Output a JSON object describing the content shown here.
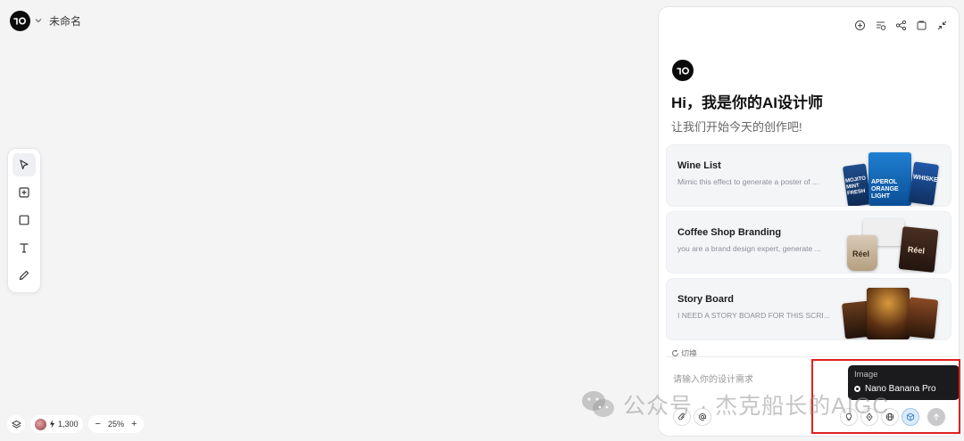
{
  "header": {
    "title": "未命名"
  },
  "toolbar": {
    "tools": [
      {
        "name": "select",
        "icon": "cursor-arrow-icon",
        "active": true
      },
      {
        "name": "add",
        "icon": "plus-square-icon"
      },
      {
        "name": "frame",
        "icon": "square-icon"
      },
      {
        "name": "text",
        "icon": "text-icon"
      },
      {
        "name": "pen",
        "icon": "pen-icon"
      }
    ]
  },
  "bottom": {
    "credits": "1,300",
    "zoom_out": "−",
    "zoom": "25%",
    "zoom_in": "+"
  },
  "panel": {
    "greeting": "Hi，我是你的AI设计师",
    "subgreeting": "让我们开始今天的创作吧!",
    "cards": [
      {
        "title": "Wine List",
        "desc": "Mimic this effect to generate a poster of ..."
      },
      {
        "title": "Coffee Shop Branding",
        "desc": "you are a brand design expert, generate ..."
      },
      {
        "title": "Story Board",
        "desc": "I NEED A STORY BOARD FOR THIS SCRI..."
      }
    ],
    "switch_label": "切换",
    "input_placeholder": "请输入你的设计需求",
    "thumb_texts": {
      "mojito": "MOJITO MINT FRESH",
      "aperol": "APEROL ORANGE LIGHT",
      "whiskey": "WHISKEY",
      "reel": "Réel"
    }
  },
  "model_menu": {
    "category": "Image",
    "option": "Nano Banana Pro"
  },
  "watermark": "公众号 · 杰克船长的AIGC",
  "colors": {
    "background": "#f4f4f5",
    "panel": "#ffffff",
    "card": "#f4f5f7",
    "accent_selected": "#dcebfb",
    "highlight": "#e02020",
    "tooltip": "#1b1b1d"
  }
}
